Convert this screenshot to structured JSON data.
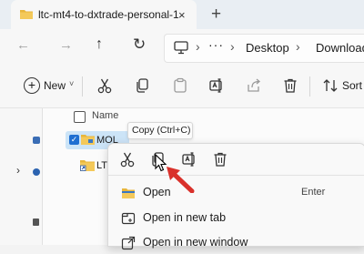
{
  "window": {
    "tab_title": "ltc-mt4-to-dxtrade-personal-1",
    "tab_close_glyph": "×",
    "new_tab_glyph": "+"
  },
  "nav": {
    "back_glyph": "←",
    "forward_glyph": "→",
    "up_glyph": "↑",
    "refresh_glyph": "↻",
    "breadcrumb_separator": "›",
    "breadcrumb_more": "···",
    "breadcrumbs": [
      "Desktop",
      "Download"
    ]
  },
  "commandbar": {
    "new_label": "New",
    "new_chevron": "˅",
    "sort_label": "Sort",
    "icons": [
      "cut-icon",
      "copy-icon",
      "paste-icon",
      "rename-icon",
      "share-icon",
      "delete-icon",
      "sort-icon"
    ]
  },
  "filelist": {
    "header_name": "Name",
    "rows": [
      {
        "name": "MOL",
        "selected": true,
        "icon": "folder-icon"
      },
      {
        "name": "LTC",
        "selected": false,
        "icon": "shortcut-folder-icon"
      }
    ]
  },
  "tooltip": {
    "text": "Copy (Ctrl+C)"
  },
  "context_menu": {
    "toolbar_icons": [
      "cut-icon",
      "copy-icon",
      "rename-icon",
      "delete-icon"
    ],
    "items": [
      {
        "label": "Open",
        "shortcut": "Enter",
        "icon": "folder-open-icon"
      },
      {
        "label": "Open in new tab",
        "icon": "new-tab-icon"
      },
      {
        "label": "Open in new window",
        "icon": "new-window-icon"
      }
    ]
  },
  "colors": {
    "accent": "#1f6fd1",
    "selection": "#cce4f7",
    "arrow": "#d9312b",
    "folder": "#e8b63c"
  }
}
